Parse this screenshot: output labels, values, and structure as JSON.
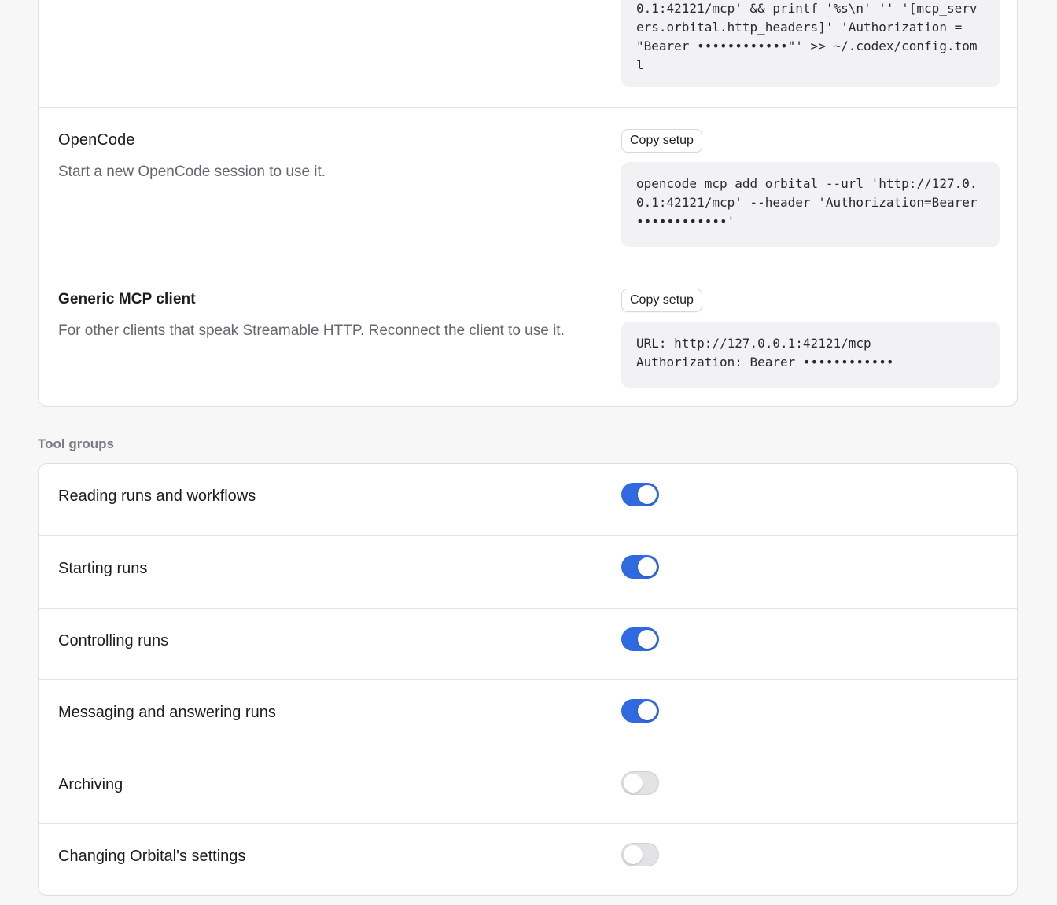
{
  "clients": [
    {
      "name": "",
      "description": "",
      "copy_label": "",
      "code": "0.1:42121/mcp' && printf '%s\\n' '' '[mcp_servers.orbital.http_headers]' 'Authorization = \"Bearer ••••••••••••\"' >> ~/.codex/config.toml"
    },
    {
      "name": "OpenCode",
      "description": "Start a new OpenCode session to use it.",
      "copy_label": "Copy setup",
      "code": "opencode mcp add orbital --url 'http://127.0.0.1:42121/mcp' --header 'Authorization=Bearer ••••••••••••'"
    },
    {
      "name": "Generic MCP client",
      "description": "For other clients that speak Streamable HTTP. Reconnect the client to use it.",
      "copy_label": "Copy setup",
      "code": "URL: http://127.0.0.1:42121/mcp\nAuthorization: Bearer ••••••••••••"
    }
  ],
  "tool_groups": {
    "heading": "Tool groups",
    "items": [
      {
        "label": "Reading runs and workflows",
        "enabled": true
      },
      {
        "label": "Starting runs",
        "enabled": true
      },
      {
        "label": "Controlling runs",
        "enabled": true
      },
      {
        "label": "Messaging and answering runs",
        "enabled": true
      },
      {
        "label": "Archiving",
        "enabled": false
      },
      {
        "label": "Changing Orbital's settings",
        "enabled": false
      }
    ]
  },
  "colors": {
    "toggle_on": "#2f6ae0",
    "toggle_off": "#e3e3e6",
    "code_bg": "#f2f2f4"
  }
}
